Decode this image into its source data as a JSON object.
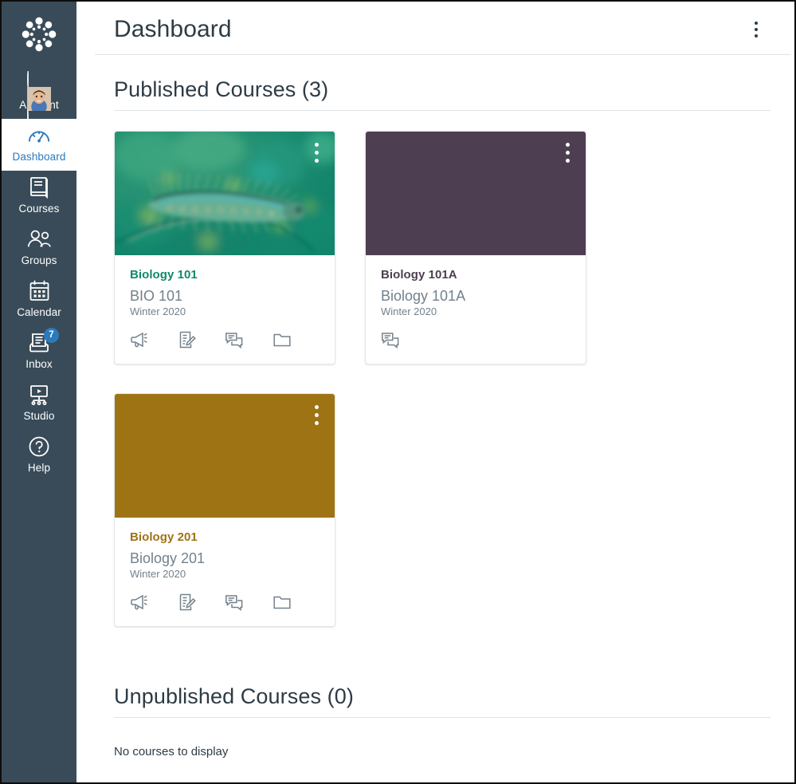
{
  "app": {
    "logo_name": "canvas-logo",
    "sidebar_bg": "#394B58",
    "accent_blue": "#2B7ABC"
  },
  "sidebar": {
    "items": [
      {
        "label": "Account",
        "icon": "avatar-icon",
        "active": false,
        "badge": null
      },
      {
        "label": "Dashboard",
        "icon": "dashboard-gauge-icon",
        "active": true,
        "badge": null
      },
      {
        "label": "Courses",
        "icon": "courses-book-icon",
        "active": false,
        "badge": null
      },
      {
        "label": "Groups",
        "icon": "groups-people-icon",
        "active": false,
        "badge": null
      },
      {
        "label": "Calendar",
        "icon": "calendar-icon",
        "active": false,
        "badge": null
      },
      {
        "label": "Inbox",
        "icon": "inbox-tray-icon",
        "active": false,
        "badge": "7"
      },
      {
        "label": "Studio",
        "icon": "studio-screen-icon",
        "active": false,
        "badge": null
      },
      {
        "label": "Help",
        "icon": "help-question-icon",
        "active": false,
        "badge": null
      }
    ]
  },
  "header": {
    "title": "Dashboard",
    "options_icon": "kebab-menu-icon"
  },
  "published": {
    "heading": "Published Courses (3)",
    "courses": [
      {
        "title": "Biology 101",
        "code": "BIO 101",
        "term": "Winter 2020",
        "color": "#0E8A6B",
        "header_style": "image-caterpillar",
        "actions": [
          {
            "name": "announcements-icon",
            "label": "Announcements"
          },
          {
            "name": "assignments-icon",
            "label": "Assignments"
          },
          {
            "name": "discussions-icon",
            "label": "Discussions"
          },
          {
            "name": "files-icon",
            "label": "Files"
          }
        ]
      },
      {
        "title": "Biology 101A",
        "code": "Biology 101A",
        "term": "Winter 2020",
        "color": "#4E3E52",
        "header_style": "solid",
        "actions": [
          {
            "name": "discussions-icon",
            "label": "Discussions"
          }
        ]
      },
      {
        "title": "Biology 201",
        "code": "Biology 201",
        "term": "Winter 2020",
        "color": "#9E7313",
        "header_style": "solid",
        "actions": [
          {
            "name": "announcements-icon",
            "label": "Announcements"
          },
          {
            "name": "assignments-icon",
            "label": "Assignments"
          },
          {
            "name": "discussions-icon",
            "label": "Discussions"
          },
          {
            "name": "files-icon",
            "label": "Files"
          }
        ]
      }
    ]
  },
  "unpublished": {
    "heading": "Unpublished Courses (0)",
    "empty_message": "No courses to display"
  }
}
